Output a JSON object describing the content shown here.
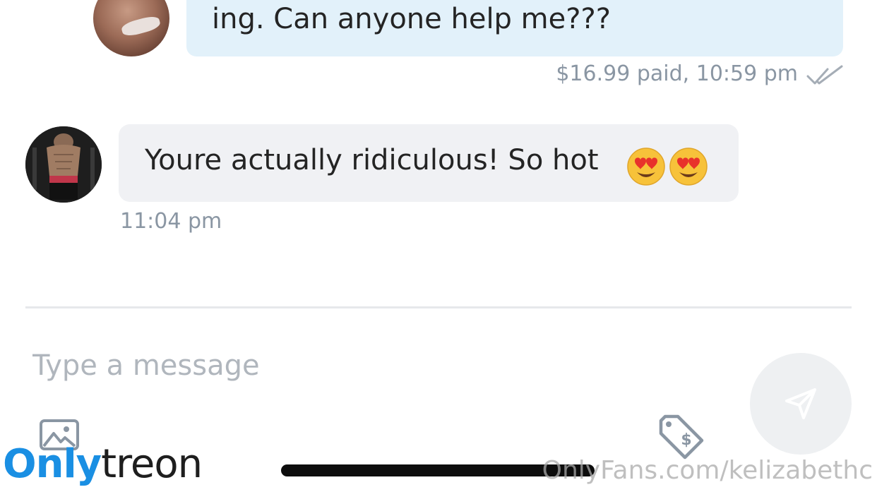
{
  "messages": [
    {
      "direction": "sent",
      "text": "ing. Can anyone help me???",
      "meta": "$16.99 paid, 10:59 pm",
      "read_icon": "double-check-icon"
    },
    {
      "direction": "received",
      "text": "Youre actually ridiculous! So hot",
      "emojis": [
        "heart-eyes-emoji",
        "heart-eyes-emoji"
      ],
      "meta": "11:04 pm"
    }
  ],
  "composer": {
    "placeholder": "Type a message",
    "send_icon": "send-icon",
    "media_icon": "image-icon",
    "price_icon": "price-tag-icon"
  },
  "watermarks": {
    "left_part1": "Only",
    "left_part2": "treon",
    "right": "OnlyFans.com/kelizabethc"
  },
  "colors": {
    "sent_bubble": "#e2f1fa",
    "received_bubble": "#f0f1f4",
    "meta_text": "#8a96a3",
    "placeholder": "#b0b6bd",
    "brand_blue": "#1a8fe3"
  }
}
